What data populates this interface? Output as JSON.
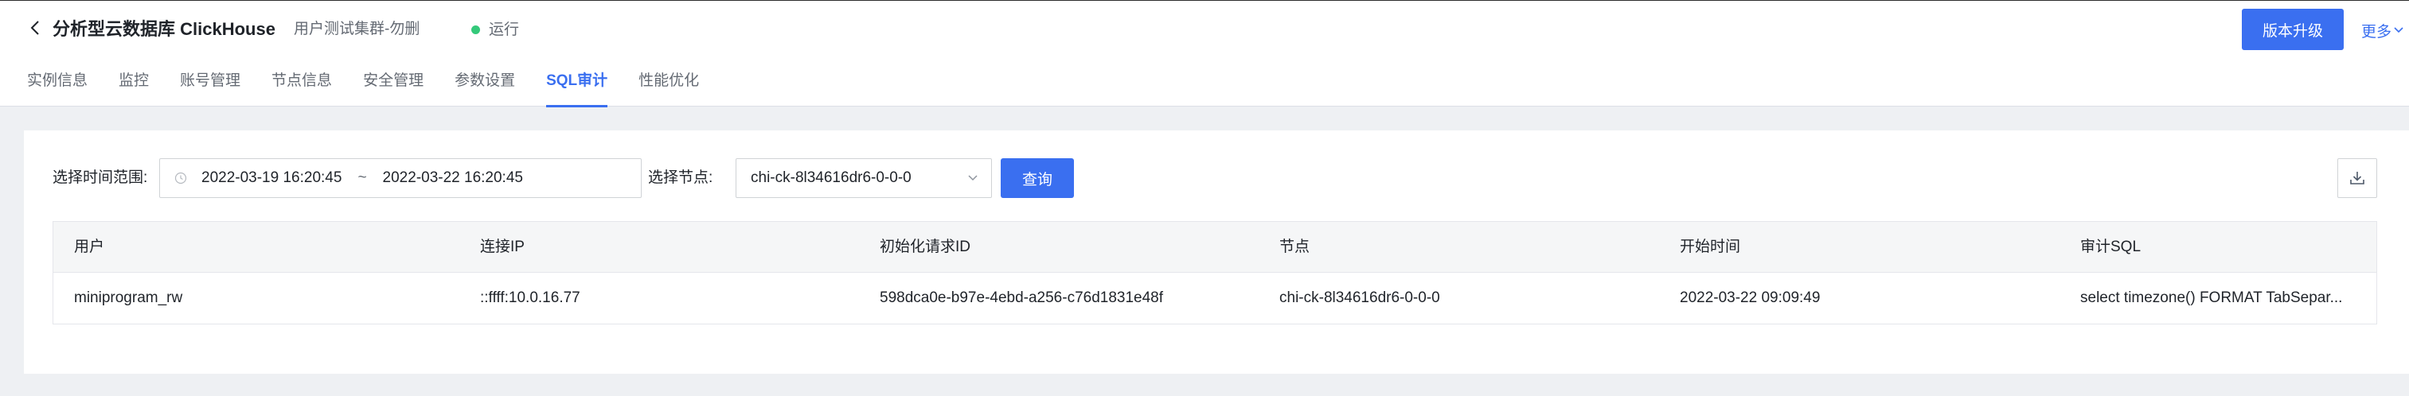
{
  "header": {
    "title": "分析型云数据库 ClickHouse",
    "cluster_name": "用户测试集群-勿删",
    "status": "运行",
    "status_color": "#34c97a",
    "upgrade_label": "版本升级",
    "more_label": "更多"
  },
  "tabs": [
    {
      "label": "实例信息",
      "active": false
    },
    {
      "label": "监控",
      "active": false
    },
    {
      "label": "账号管理",
      "active": false
    },
    {
      "label": "节点信息",
      "active": false
    },
    {
      "label": "安全管理",
      "active": false
    },
    {
      "label": "参数设置",
      "active": false
    },
    {
      "label": "SQL审计",
      "active": true
    },
    {
      "label": "性能优化",
      "active": false
    }
  ],
  "filters": {
    "time_range_label": "选择时间范围:",
    "start_time": "2022-03-19 16:20:45",
    "separator": "~",
    "end_time": "2022-03-22 16:20:45",
    "node_label": "选择节点:",
    "node_value": "chi-ck-8l34616dr6-0-0-0",
    "query_label": "查询"
  },
  "table": {
    "columns": [
      "用户",
      "连接IP",
      "初始化请求ID",
      "节点",
      "开始时间",
      "审计SQL"
    ],
    "rows": [
      [
        "miniprogram_rw",
        "::ffff:10.0.16.77",
        "598dca0e-b97e-4ebd-a256-c76d1831e48f",
        "chi-ck-8l34616dr6-0-0-0",
        "2022-03-22 09:09:49",
        "select timezone() FORMAT TabSepar..."
      ]
    ]
  },
  "colors": {
    "accent": "#3a6ff0",
    "page_bg": "#eef0f3"
  },
  "icons": {
    "back": "chevron-left-icon",
    "status": "status-dot-icon",
    "more": "chevron-down-icon",
    "clock": "clock-icon",
    "select": "chevron-down-icon",
    "download": "download-icon"
  }
}
